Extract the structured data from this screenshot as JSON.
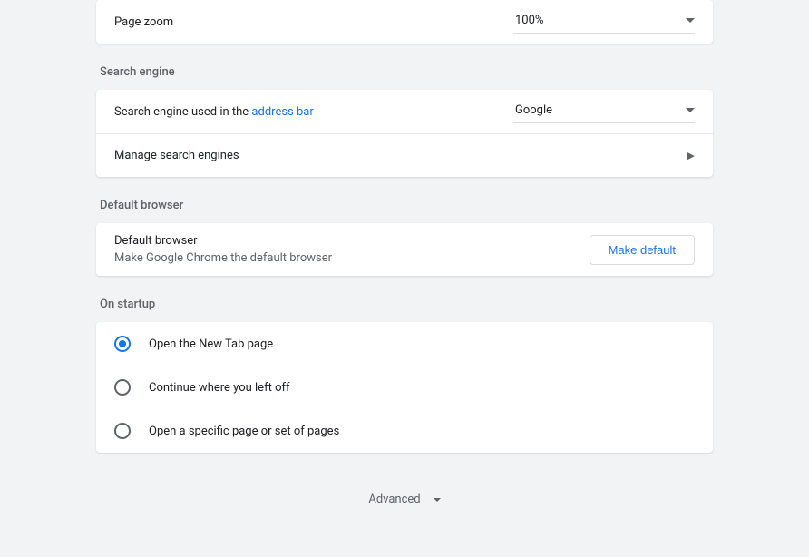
{
  "page_zoom": {
    "label": "Page zoom",
    "value": "100%"
  },
  "search_engine": {
    "section_title": "Search engine",
    "used_in_label_prefix": "Search engine used in the ",
    "used_in_link": "address bar",
    "selected": "Google",
    "manage_label": "Manage search engines"
  },
  "default_browser": {
    "section_title": "Default browser",
    "title": "Default browser",
    "subtitle": "Make Google Chrome the default browser",
    "button_label": "Make default"
  },
  "on_startup": {
    "section_title": "On startup",
    "options": [
      {
        "label": "Open the New Tab page",
        "selected": true
      },
      {
        "label": "Continue where you left off",
        "selected": false
      },
      {
        "label": "Open a specific page or set of pages",
        "selected": false
      }
    ]
  },
  "advanced_label": "Advanced"
}
